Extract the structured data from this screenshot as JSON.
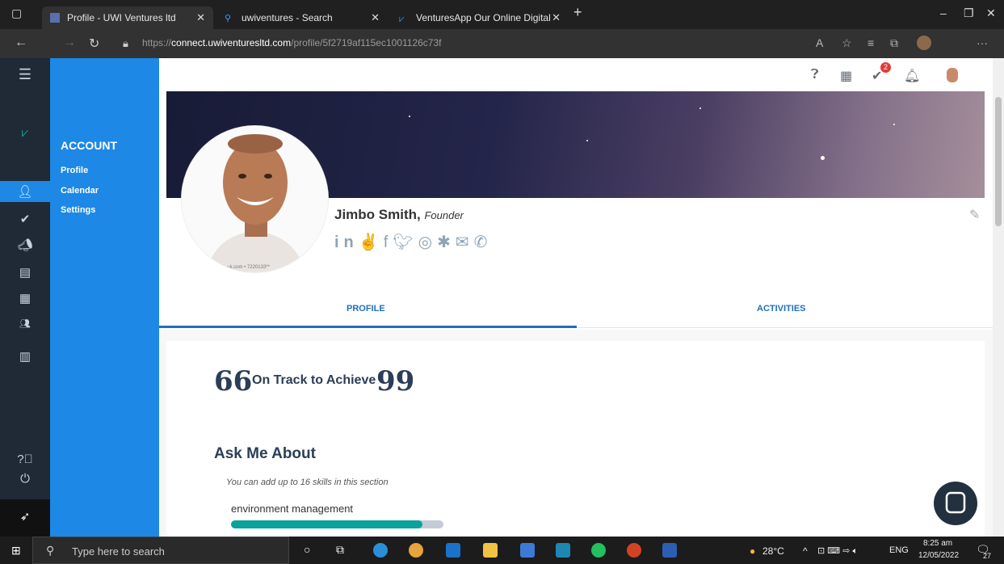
{
  "browser": {
    "tabs": [
      {
        "title": "Profile - UWI Ventures ltd",
        "active": true
      },
      {
        "title": "uwiventures - Search",
        "active": false
      },
      {
        "title": "VenturesApp Our Online Digital",
        "active": false
      }
    ],
    "new_tab": "+",
    "url_prefix": "https://",
    "url_domain": "connect.uwiventuresltd.com",
    "url_path": "/profile/5f2719af115ec1001126c73f"
  },
  "sidebar": {
    "heading": "ACCOUNT",
    "items": [
      {
        "label": "Profile"
      },
      {
        "label": "Calendar"
      },
      {
        "label": "Settings"
      }
    ]
  },
  "topbar": {
    "notification_count": "2"
  },
  "profile": {
    "name": "Jimbo Smith,",
    "role": "Founder",
    "avatar_caption": "~k.com • 7220133**"
  },
  "tabs": {
    "profile": "PROFILE",
    "activities": "ACTIVITIES"
  },
  "quote": {
    "text": "On Track to Achieve",
    "open": "66",
    "close": "99"
  },
  "ask": {
    "title": "Ask Me About",
    "hint": "You can add up to 16 skills in this section",
    "skills": [
      {
        "name": "environment management",
        "level": 0.9
      }
    ]
  },
  "taskbar": {
    "search_placeholder": "Type here to search",
    "weather": "28°C",
    "lang": "ENG",
    "time": "8:25 am",
    "date": "12/05/2022",
    "badge": "27"
  },
  "colors": {
    "accent": "#1d88e5",
    "rail": "#1f2a36",
    "skill_fill": "#0ba29a"
  }
}
